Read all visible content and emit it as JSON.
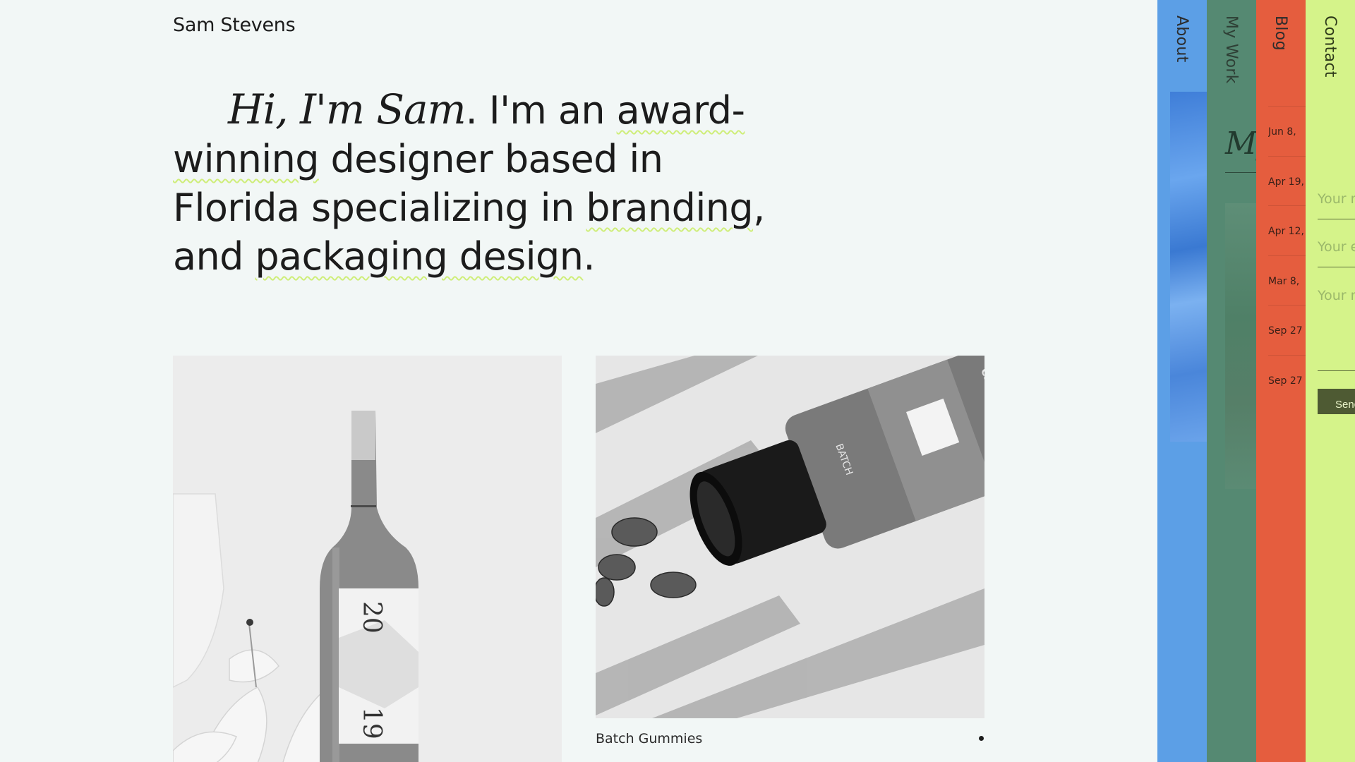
{
  "site": {
    "name": "Sam Stevens"
  },
  "intro": {
    "greeting": "Hi, I'm Sam",
    "text_a": ". I'm an ",
    "hl_1": "award-winning",
    "text_b": " designer based in Florida specializing in ",
    "hl_2": "branding",
    "text_c": ", and ",
    "hl_3": "packaging design",
    "text_d": "."
  },
  "projects": [
    {
      "label_on_bottle_top": "20",
      "label_on_bottle_bottom": "19"
    },
    {
      "caption": "Batch Gummies",
      "bottle_text": "BATCH",
      "bottle_subtext": "CBD SOFTGELS"
    }
  ],
  "panels": {
    "about": {
      "label": "About",
      "color": "#5c9fe6"
    },
    "work": {
      "label": "My Work",
      "color": "#558972",
      "title_fragment": "My"
    },
    "blog": {
      "label": "Blog",
      "color": "#e55d3e",
      "dates": [
        "Jun 8,",
        "Apr 19,",
        "Apr 12,",
        "Mar 8,",
        "Sep 27",
        "Sep 27"
      ]
    },
    "contact": {
      "label": "Contact",
      "color": "#d5f38a",
      "name_placeholder": "Your name",
      "email_placeholder": "Your email",
      "message_placeholder": "Your message",
      "send_label": "Send"
    }
  },
  "colors": {
    "background": "#f2f7f6",
    "underline": "#cfee7a",
    "text": "#1c1c1c"
  }
}
